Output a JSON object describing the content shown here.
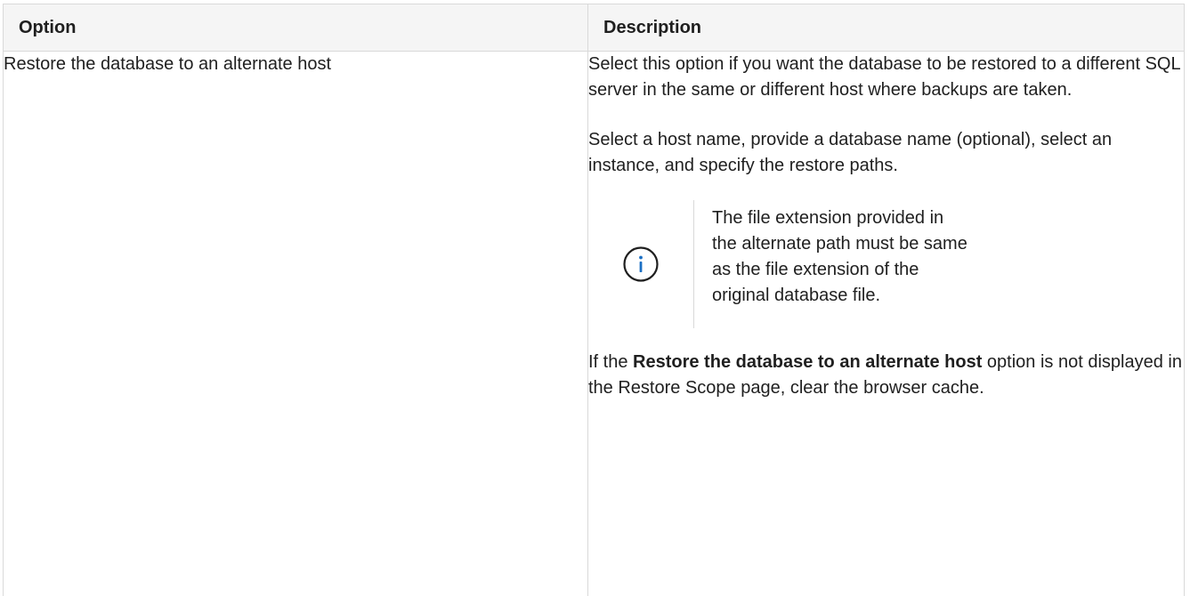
{
  "table": {
    "headers": {
      "option": "Option",
      "description": "Description"
    },
    "rows": [
      {
        "option": "Restore the database to an alternate host",
        "description": {
          "paragraph_1": "Select this option if you want the database to be restored to a different SQL server in the same or different host where backups are taken.",
          "paragraph_2": "Select a host name, provide a database name (optional), select an instance, and specify the restore paths.",
          "note": {
            "icon": "info-circle-icon",
            "text": "The file extension provided in the alternate path must be same as the file extension of the original database file."
          },
          "paragraph_3": {
            "prefix": "If the ",
            "bold": "Restore the database to an alternate host",
            "suffix": " option is not displayed in the Restore Scope page, clear the browser cache."
          }
        }
      }
    ]
  },
  "colors": {
    "header_bg": "#f5f5f5",
    "border": "#d9d9d9",
    "text": "#1f1f1f",
    "icon_stroke": "#1f1f1f",
    "icon_accent": "#1a6fc4"
  }
}
